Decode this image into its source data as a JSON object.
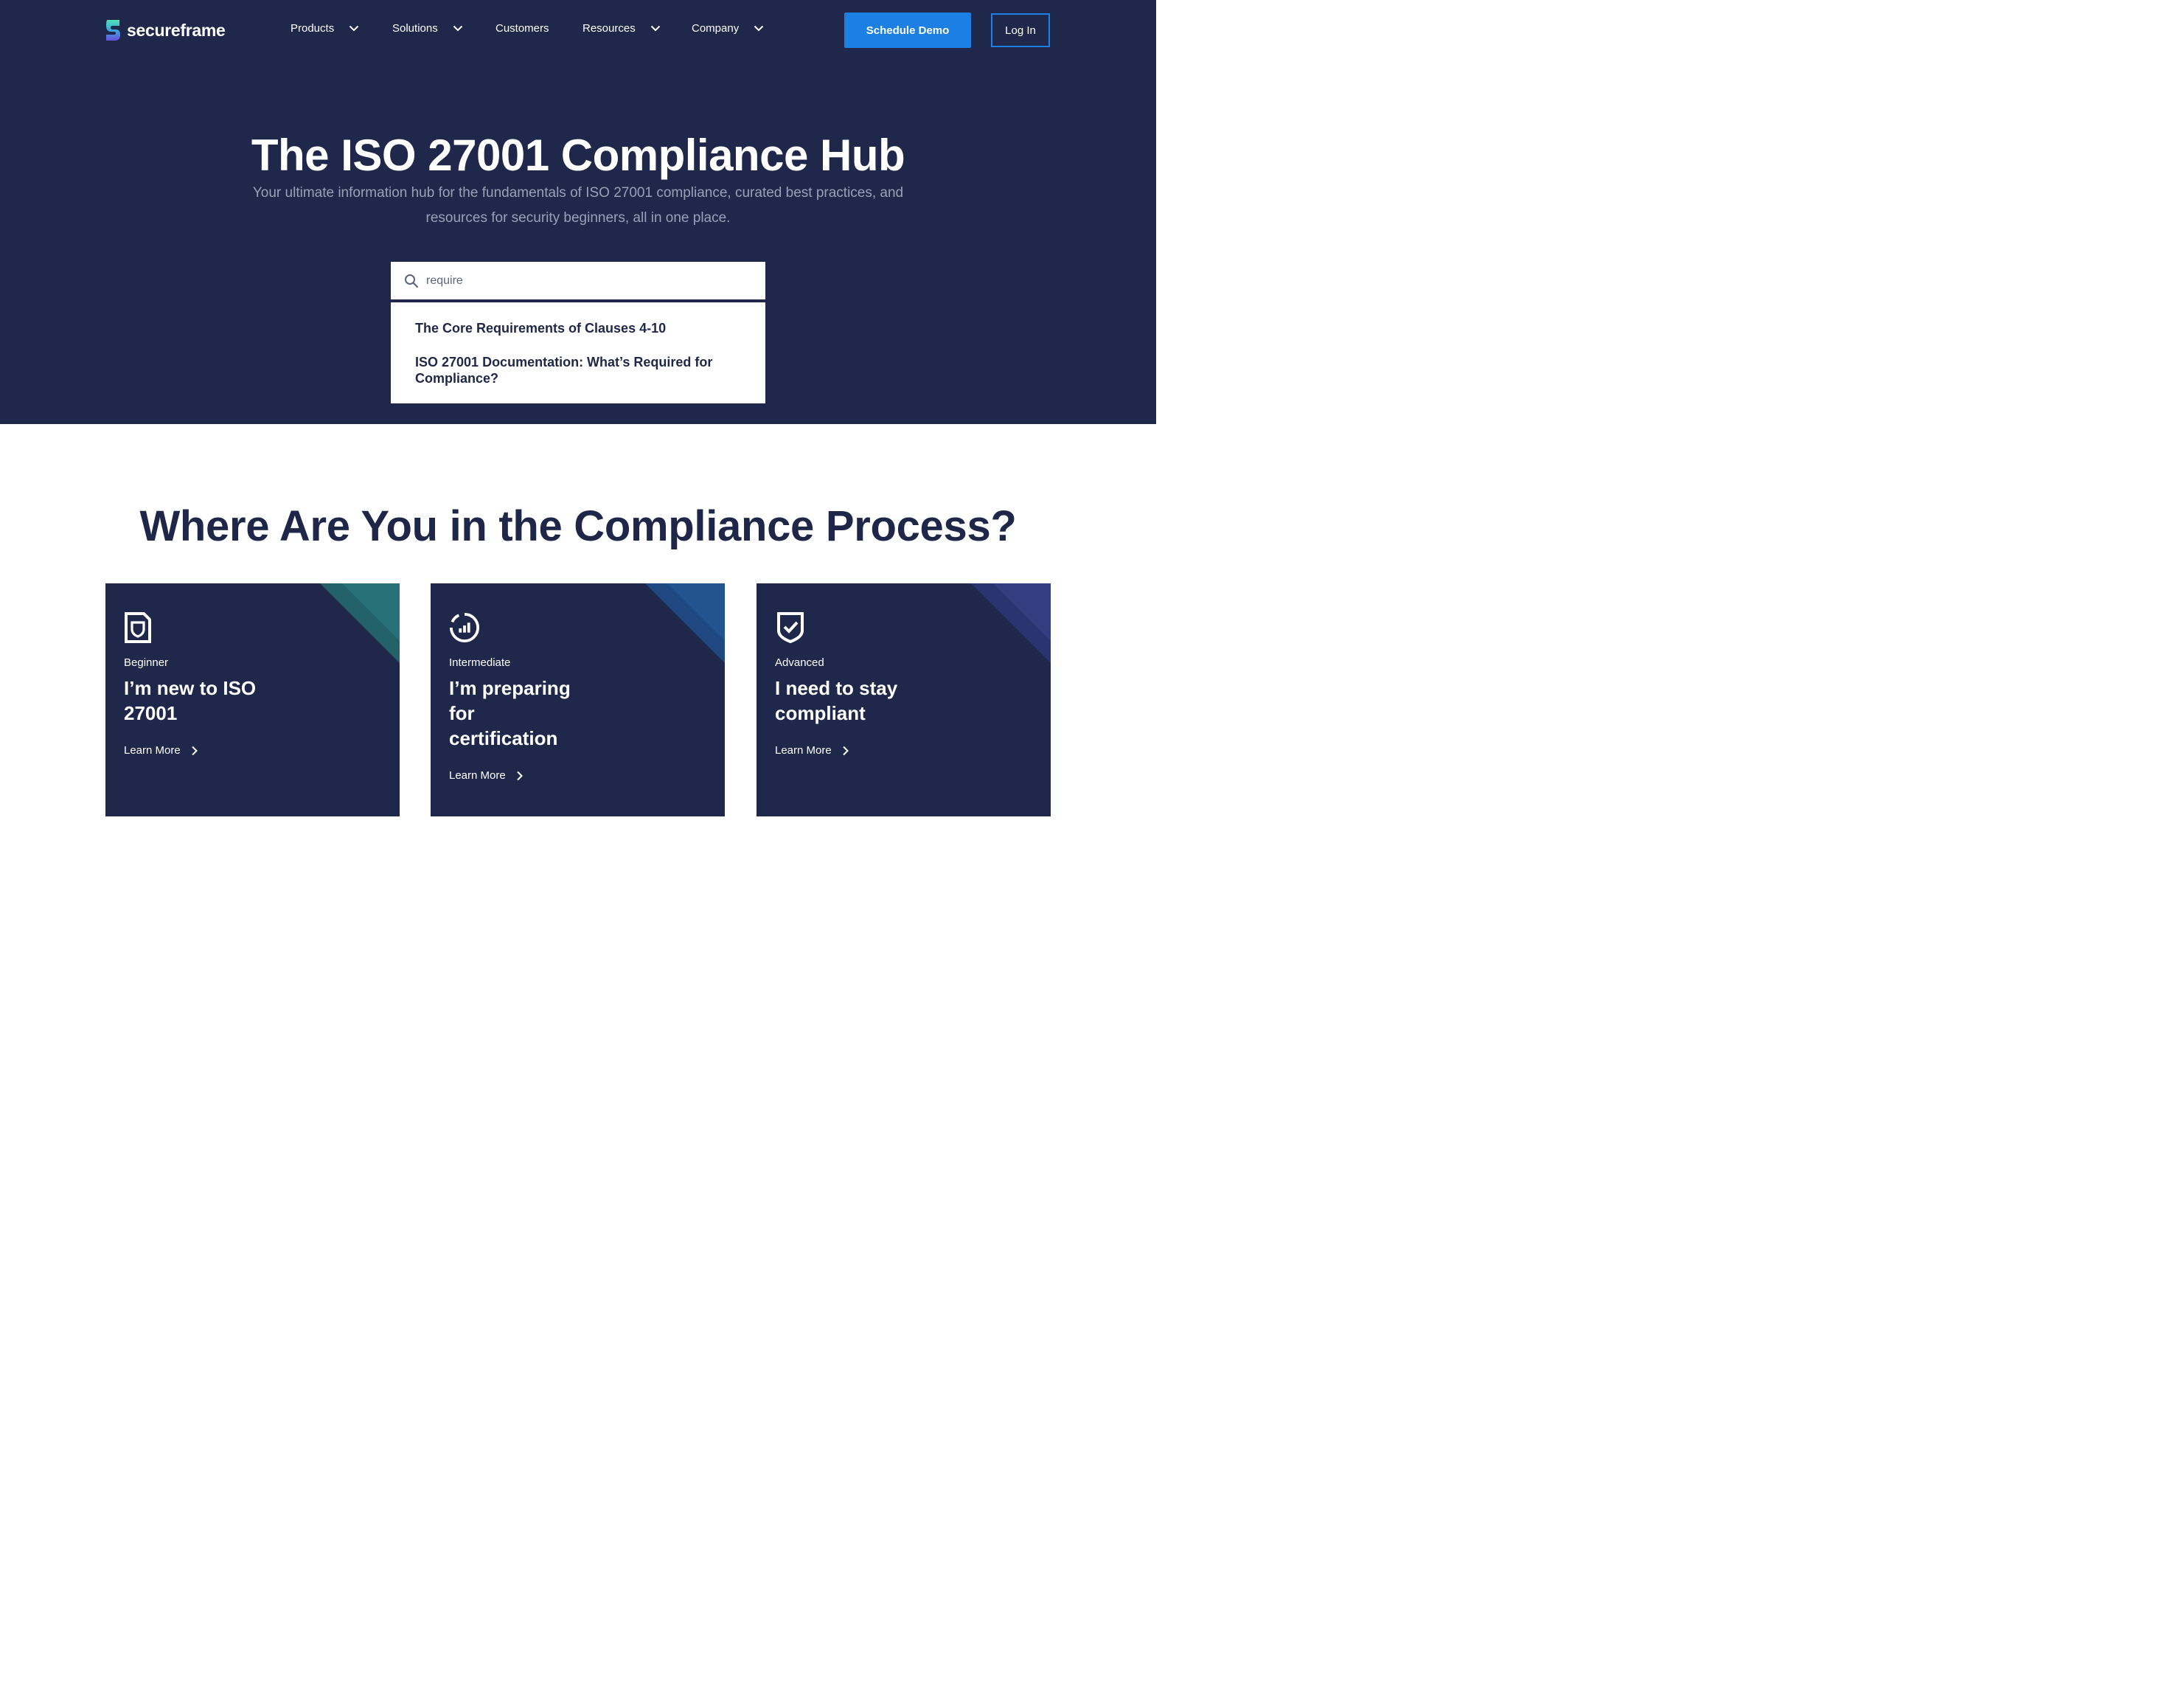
{
  "brand": {
    "name": "secureframe"
  },
  "nav": {
    "items": [
      {
        "label": "Products",
        "dropdown": true
      },
      {
        "label": "Solutions",
        "dropdown": true
      },
      {
        "label": "Customers",
        "dropdown": false
      },
      {
        "label": "Resources",
        "dropdown": true
      },
      {
        "label": "Company",
        "dropdown": true
      }
    ],
    "cta": "Schedule Demo",
    "login": "Log In"
  },
  "hero": {
    "title": "The ISO 27001 Compliance Hub",
    "subtitle": "Your ultimate information hub for the fundamentals of ISO 27001 compliance, curated best practices, and resources for security beginners, all in one place."
  },
  "search": {
    "value": "require",
    "results": [
      "The Core Requirements of Clauses 4-10",
      "ISO 27001 Documentation: What’s Required for Compliance?"
    ]
  },
  "section": {
    "title": "Where Are You in the Compliance Process?"
  },
  "cards": [
    {
      "level": "Beginner",
      "heading": "I’m new to ISO 27001",
      "link": "Learn More",
      "accent": "#24626a",
      "icon": "document-shield-icon"
    },
    {
      "level": "Intermediate",
      "heading": "I’m preparing for certification",
      "link": "Learn More",
      "accent": "#21508e",
      "icon": "progress-chart-icon"
    },
    {
      "level": "Advanced",
      "heading": "I need to stay compliant",
      "link": "Learn More",
      "accent": "#323a7a",
      "icon": "shield-check-icon"
    }
  ],
  "colors": {
    "navy": "#1f284b",
    "accent_blue": "#1c7fe4",
    "white": "#ffffff"
  }
}
